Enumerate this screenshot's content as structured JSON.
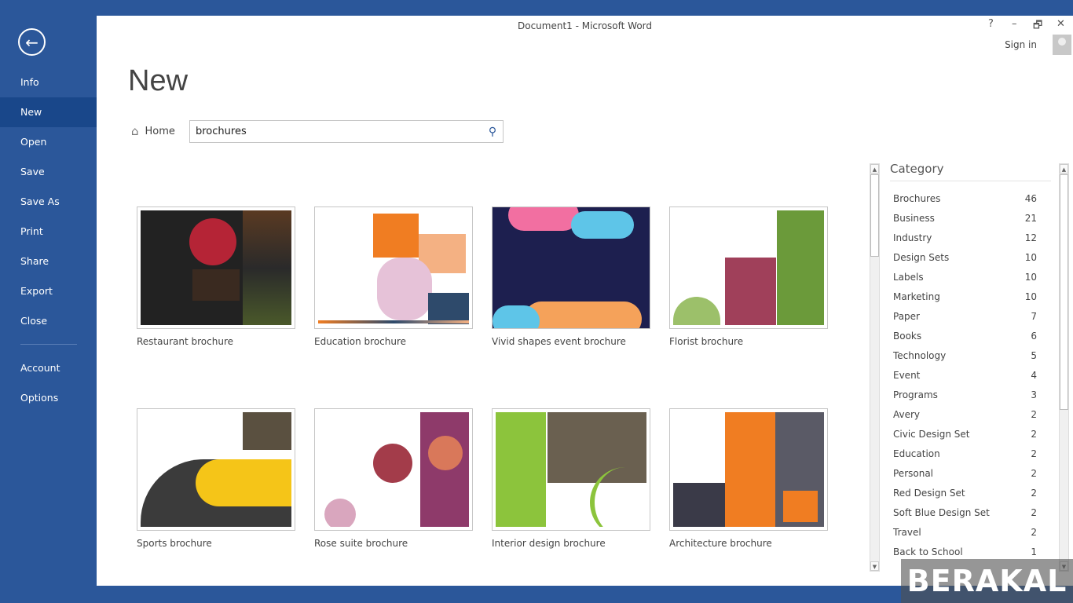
{
  "window": {
    "title": "Document1 - Microsoft Word",
    "help": "?",
    "minimize": "–",
    "restore": "🗗",
    "close": "✕",
    "sign_in": "Sign in"
  },
  "sidebar": {
    "back": "←",
    "items": [
      {
        "label": "Info"
      },
      {
        "label": "New",
        "active": true
      },
      {
        "label": "Open"
      },
      {
        "label": "Save"
      },
      {
        "label": "Save As"
      },
      {
        "label": "Print"
      },
      {
        "label": "Share"
      },
      {
        "label": "Export"
      },
      {
        "label": "Close"
      },
      {
        "label": "Account"
      },
      {
        "label": "Options"
      }
    ]
  },
  "main": {
    "heading": "New",
    "home": "Home",
    "search_value": "brochures",
    "templates": [
      {
        "name": "Restaurant brochure"
      },
      {
        "name": "Education brochure"
      },
      {
        "name": "Vivid shapes event brochure"
      },
      {
        "name": "Florist brochure"
      },
      {
        "name": "Sports brochure"
      },
      {
        "name": "Rose suite brochure"
      },
      {
        "name": "Interior design brochure"
      },
      {
        "name": "Architecture brochure"
      }
    ]
  },
  "category": {
    "title": "Category",
    "items": [
      {
        "name": "Brochures",
        "count": "46"
      },
      {
        "name": "Business",
        "count": "21"
      },
      {
        "name": "Industry",
        "count": "12"
      },
      {
        "name": "Design Sets",
        "count": "10"
      },
      {
        "name": "Labels",
        "count": "10"
      },
      {
        "name": "Marketing",
        "count": "10"
      },
      {
        "name": "Paper",
        "count": "7"
      },
      {
        "name": "Books",
        "count": "6"
      },
      {
        "name": "Technology",
        "count": "5"
      },
      {
        "name": "Event",
        "count": "4"
      },
      {
        "name": "Programs",
        "count": "3"
      },
      {
        "name": "Avery",
        "count": "2"
      },
      {
        "name": "Civic Design Set",
        "count": "2"
      },
      {
        "name": "Education",
        "count": "2"
      },
      {
        "name": "Personal",
        "count": "2"
      },
      {
        "name": "Red Design Set",
        "count": "2"
      },
      {
        "name": "Soft Blue Design Set",
        "count": "2"
      },
      {
        "name": "Travel",
        "count": "2"
      },
      {
        "name": "Back to School",
        "count": "1"
      }
    ]
  },
  "watermark": "BERAKAL",
  "colors": {
    "accent": "#2b579a",
    "active_nav": "#19478a"
  }
}
